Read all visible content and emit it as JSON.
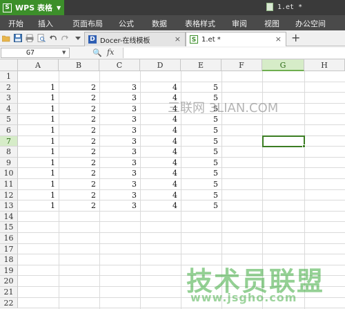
{
  "title_bar": {
    "app_menu_label": "WPS 表格",
    "app_logo_glyph": "S",
    "document_indicator": "1.et *"
  },
  "menubar": {
    "items": [
      "开始",
      "插入",
      "页面布局",
      "公式",
      "数据",
      "表格样式",
      "审阅",
      "视图",
      "办公空间"
    ]
  },
  "tabs": [
    {
      "label": "Docer-在线模板",
      "icon": "docer-icon",
      "close": "×"
    },
    {
      "label": "1.et *",
      "icon": "spreadsheet-icon",
      "close": "×"
    }
  ],
  "tab_add_label": "+",
  "formula_bar": {
    "cell_reference": "G7",
    "fx_label": "fx",
    "formula_value": ""
  },
  "grid": {
    "columns": [
      "A",
      "B",
      "C",
      "D",
      "E",
      "F",
      "G",
      "H"
    ],
    "rows": [
      "1",
      "2",
      "3",
      "4",
      "5",
      "6",
      "7",
      "8",
      "9",
      "10",
      "11",
      "12",
      "13",
      "14",
      "15",
      "16",
      "17",
      "18",
      "19",
      "20",
      "21",
      "22"
    ],
    "active_column": "G",
    "active_row": "7",
    "data_rows": [
      [
        "1",
        "2",
        "3",
        "4",
        "5"
      ],
      [
        "1",
        "2",
        "3",
        "4",
        "5"
      ],
      [
        "1",
        "2",
        "3",
        "4",
        "5"
      ],
      [
        "1",
        "2",
        "3",
        "4",
        "5"
      ],
      [
        "1",
        "2",
        "3",
        "4",
        "5"
      ],
      [
        "1",
        "2",
        "3",
        "4",
        "5"
      ],
      [
        "1",
        "2",
        "3",
        "4",
        "5"
      ],
      [
        "1",
        "2",
        "3",
        "4",
        "5"
      ],
      [
        "1",
        "2",
        "3",
        "4",
        "5"
      ],
      [
        "1",
        "2",
        "3",
        "4",
        "5"
      ],
      [
        "1",
        "2",
        "3",
        "4",
        "5"
      ],
      [
        "1",
        "2",
        "3",
        "4",
        "5"
      ]
    ]
  },
  "watermarks": {
    "site1": "三联网 3LIAN.COM",
    "site2_title": "技术员联盟",
    "site2_url": "www.jsgho.com"
  },
  "colors": {
    "accent_green": "#3c8f2a",
    "selection_green": "#3b7d23",
    "active_header_bg": "#d6ecc8"
  }
}
